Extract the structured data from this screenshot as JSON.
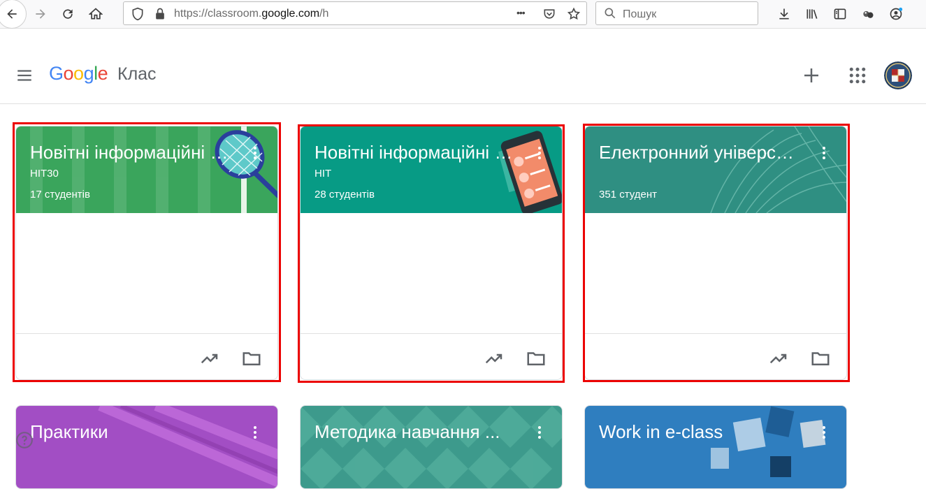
{
  "browser": {
    "url_prefix": "https://classroom.",
    "url_domain": "google.com",
    "url_suffix": "/h",
    "search_placeholder": "Пошук",
    "more_dots": "•••"
  },
  "app": {
    "logo_letters": [
      "G",
      "o",
      "o",
      "g",
      "l",
      "e"
    ],
    "logo_colors": [
      "#4285F4",
      "#EA4335",
      "#FBBC05",
      "#4285F4",
      "#34A853",
      "#EA4335"
    ],
    "product_name": "Клас"
  },
  "courses": [
    {
      "title": "Новітні інформаційні технології",
      "section": "НІТ30",
      "students": "17 студентів",
      "color": "#3aa55c"
    },
    {
      "title": "Новітні інформаційні технології",
      "section": "НІТ",
      "students": "28 студентів",
      "color": "#079b85"
    },
    {
      "title": "Електронний університет",
      "section": "",
      "students": "351 студент",
      "color": "#2f8f82"
    },
    {
      "title": "Практики",
      "section": "",
      "students": "",
      "color": "#a24ec4"
    },
    {
      "title": "Методика навчання ...",
      "section": "",
      "students": "",
      "color": "#3d9a8c"
    },
    {
      "title": "Work in e-class",
      "section": "",
      "students": "",
      "color": "#2f7ebf"
    }
  ],
  "highlight_color": "#ec0000"
}
